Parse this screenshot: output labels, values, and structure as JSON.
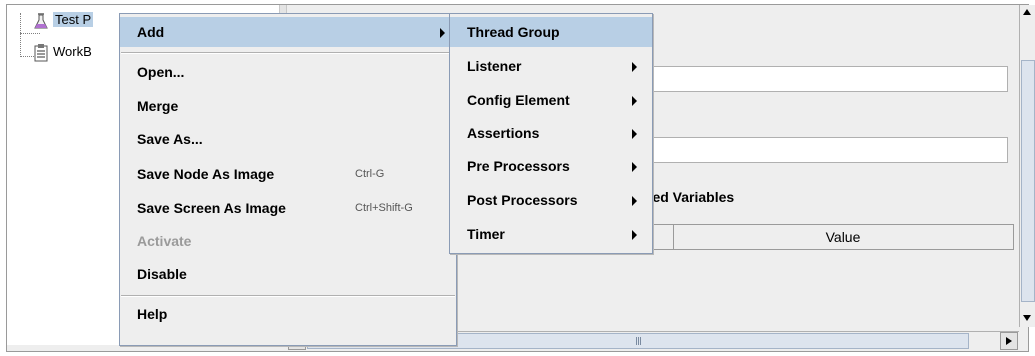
{
  "tree": {
    "nodes": [
      {
        "label": "Test P",
        "icon": "flask-icon"
      },
      {
        "label": "WorkB",
        "icon": "clipboard-icon"
      }
    ]
  },
  "main_menu": {
    "items": [
      {
        "label": "Add",
        "shortcut": "",
        "submenu": true,
        "highlighted": true,
        "enabled": true
      },
      {
        "label": "Open...",
        "shortcut": "",
        "submenu": false,
        "enabled": true
      },
      {
        "label": "Merge",
        "shortcut": "",
        "submenu": false,
        "enabled": true
      },
      {
        "label": "Save As...",
        "shortcut": "",
        "submenu": false,
        "enabled": true
      },
      {
        "label": "Save Node As Image",
        "shortcut": "Ctrl-G",
        "submenu": false,
        "enabled": true
      },
      {
        "label": "Save Screen As Image",
        "shortcut": "Ctrl+Shift-G",
        "submenu": false,
        "enabled": true
      },
      {
        "label": "Activate",
        "shortcut": "",
        "submenu": false,
        "enabled": false
      },
      {
        "label": "Disable",
        "shortcut": "",
        "submenu": false,
        "enabled": true
      },
      {
        "label": "Help",
        "shortcut": "",
        "submenu": false,
        "enabled": true
      }
    ]
  },
  "add_submenu": {
    "items": [
      {
        "label": "Thread Group",
        "submenu": false,
        "highlighted": true
      },
      {
        "label": "Listener",
        "submenu": true
      },
      {
        "label": "Config Element",
        "submenu": true
      },
      {
        "label": "Assertions",
        "submenu": true
      },
      {
        "label": "Pre Processors",
        "submenu": true
      },
      {
        "label": "Post Processors",
        "submenu": true
      },
      {
        "label": "Timer",
        "submenu": true
      }
    ]
  },
  "panel": {
    "variables_heading_partial": "ined Variables",
    "table_value_header": "Value"
  },
  "colors": {
    "highlight": "#b8cfe5",
    "menu_bg": "#eeeeee",
    "disabled_text": "#9a9a9a"
  }
}
